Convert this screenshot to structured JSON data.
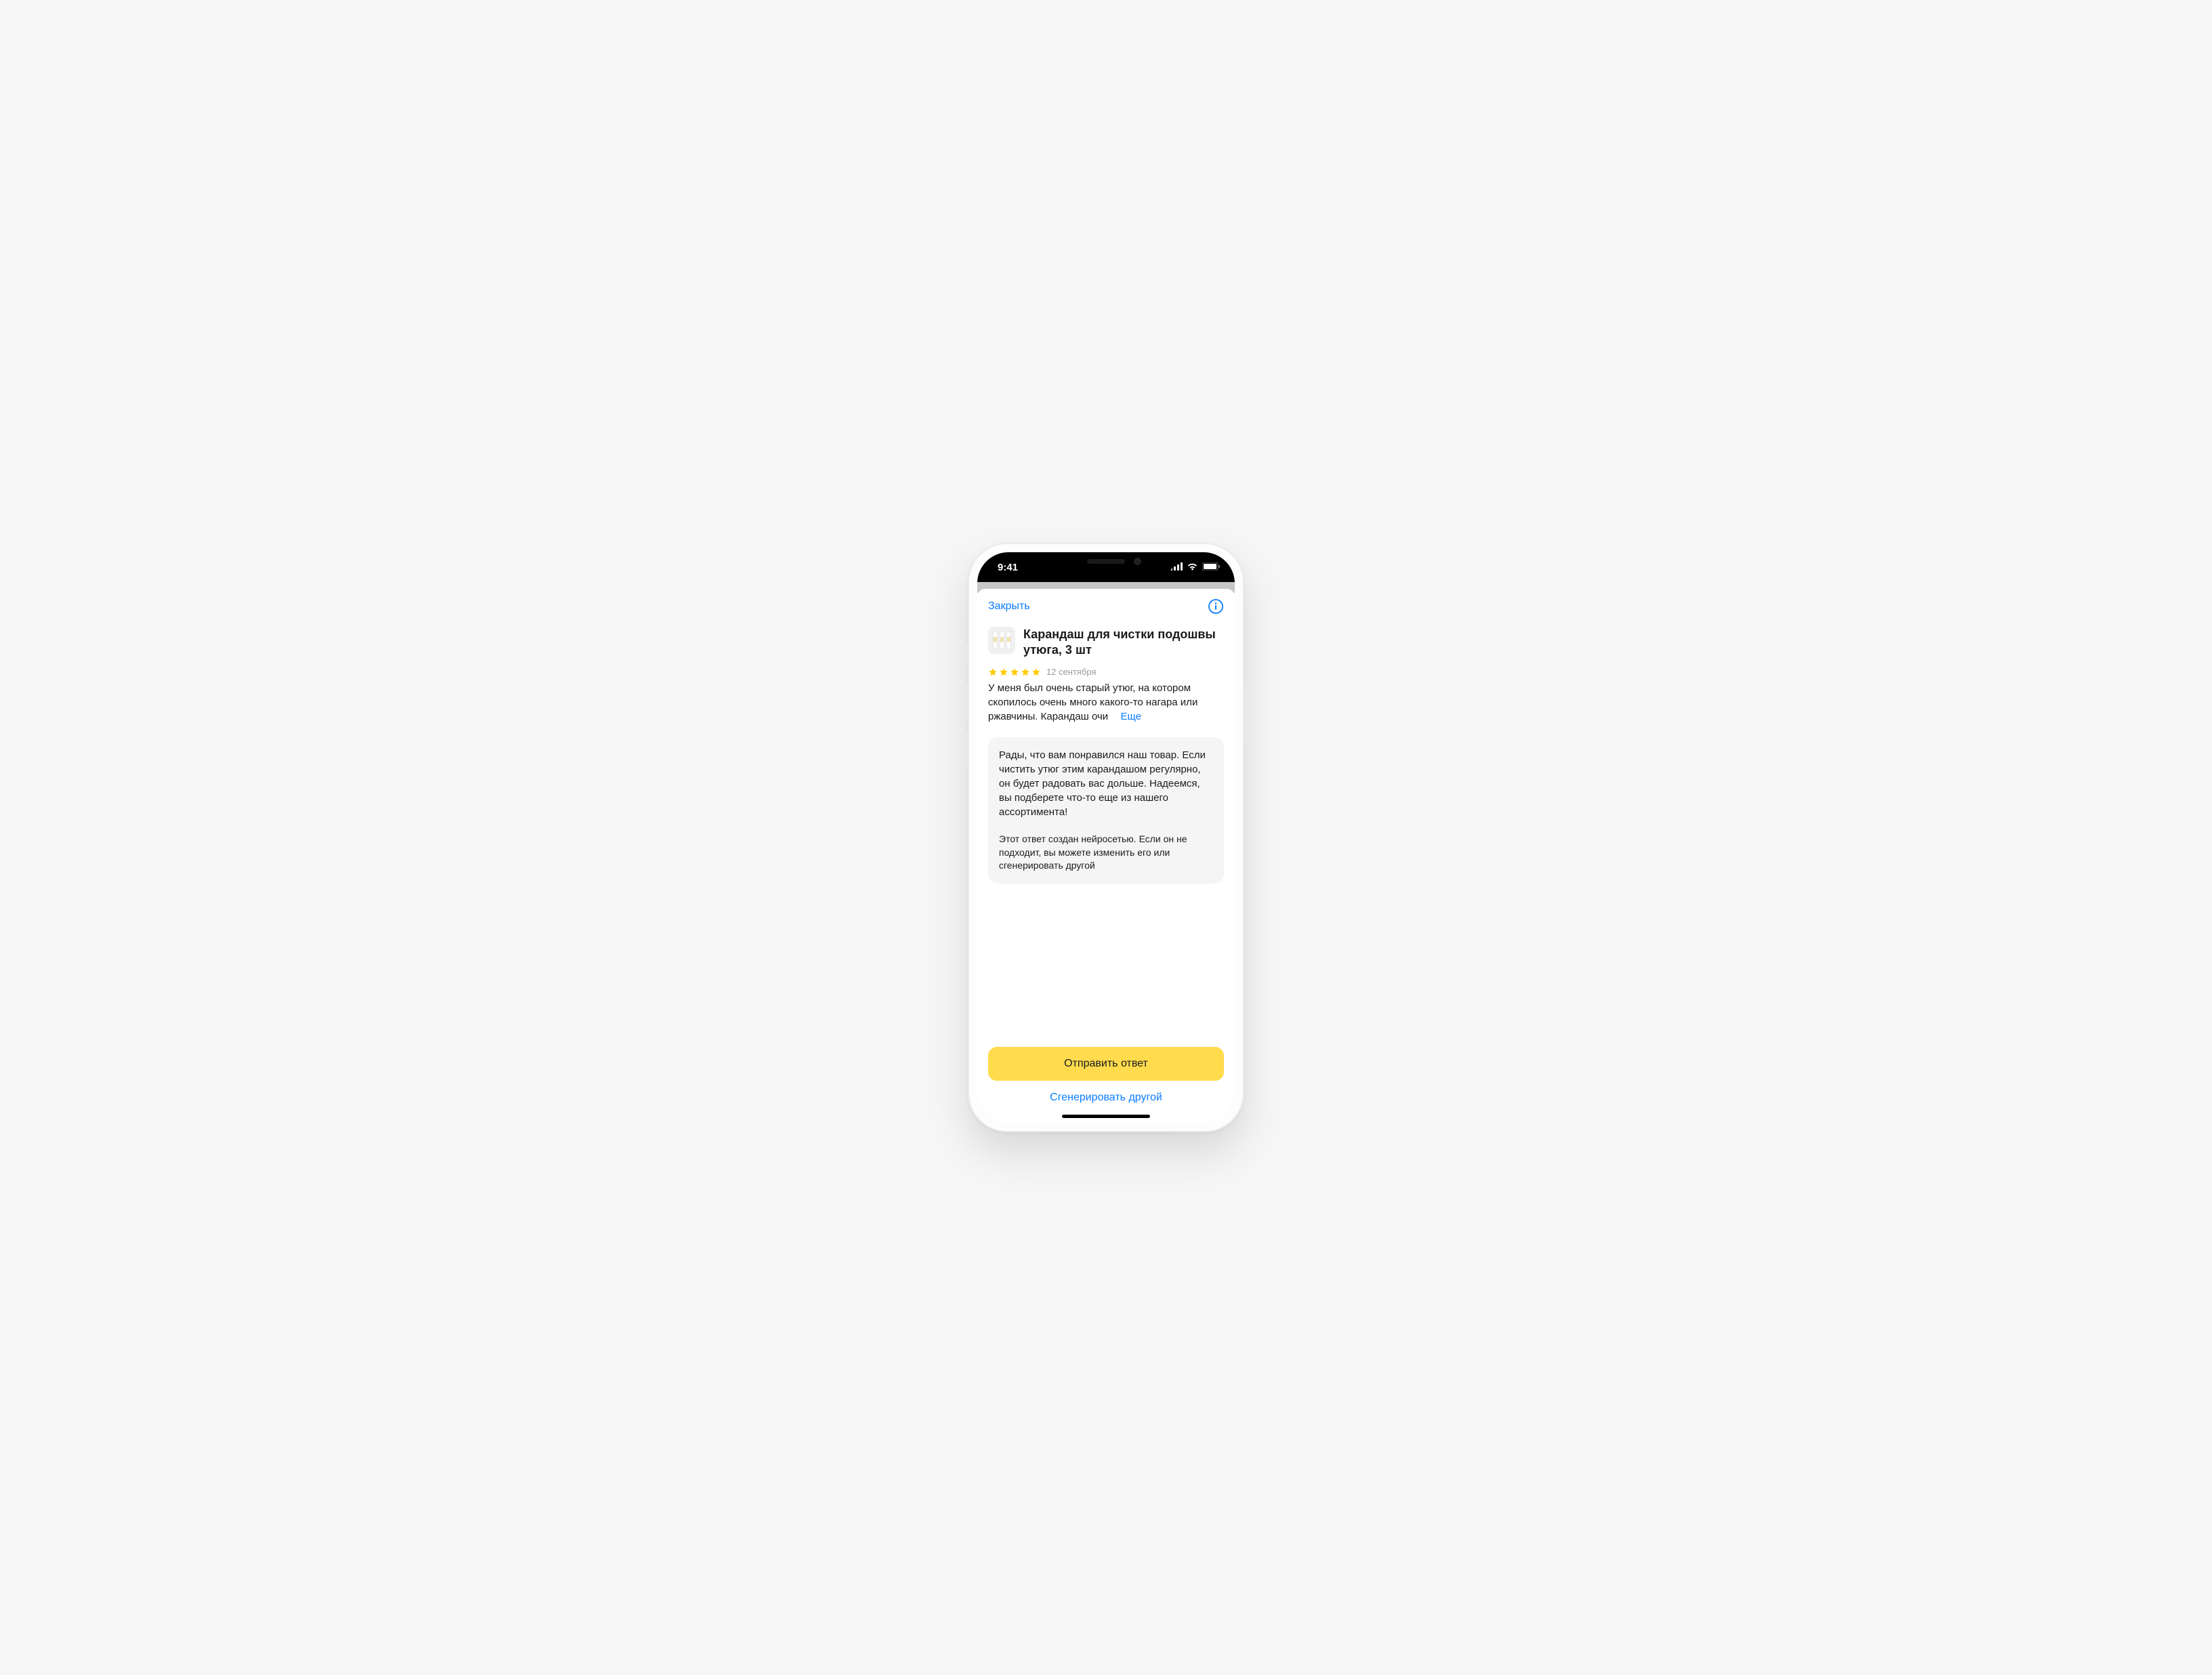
{
  "statusbar": {
    "time": "9:41"
  },
  "sheet": {
    "close_label": "Закрыть"
  },
  "product": {
    "title": "Карандаш для чистки подошвы утюга, 3 шт"
  },
  "review": {
    "rating": 5,
    "date": "12 сентября",
    "text": "У меня был очень старый утюг, на котором скопилось очень много какого-то нагара или ржавчины. Карандаш очи",
    "more_label": "Еще"
  },
  "reply": {
    "text": "Рады, что вам понравился наш товар. Если чистить утюг этим карандашом регулярно, он будет радовать вас дольше. Надеемся, вы подберете что-то еще из нашего ассортимента!",
    "ai_note": "Этот ответ создан нейросетью. Если он не подходит, вы можете изменить его или сгенерировать другой"
  },
  "actions": {
    "send_label": "Отправить ответ",
    "regenerate_label": "Сгенерировать другой"
  },
  "colors": {
    "accent_blue": "#0a7cff",
    "primary_yellow": "#ffdb4d",
    "star": "#ffcc00"
  }
}
